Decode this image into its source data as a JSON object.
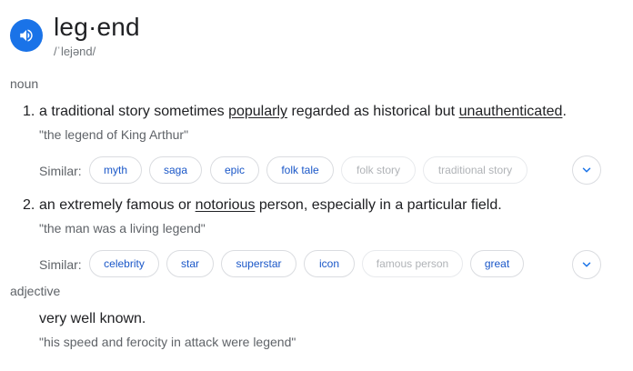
{
  "entry": {
    "word": "leg·end",
    "phonetic": "/ˈlejənd/",
    "speaker_icon": "volume-up-icon"
  },
  "noun": {
    "label": "noun",
    "senses": [
      {
        "number": "1.",
        "definition_parts": [
          {
            "text": "a traditional story sometimes ",
            "link": false
          },
          {
            "text": "popularly",
            "link": true
          },
          {
            "text": " regarded as historical but ",
            "link": false
          },
          {
            "text": "unauthenticated",
            "link": true
          },
          {
            "text": ".",
            "link": false
          }
        ],
        "example": "\"the legend of King Arthur\"",
        "similar_label": "Similar:",
        "similar": [
          {
            "text": "myth",
            "active": true
          },
          {
            "text": "saga",
            "active": true
          },
          {
            "text": "epic",
            "active": true
          },
          {
            "text": "folk tale",
            "active": true
          },
          {
            "text": "folk story",
            "active": false
          },
          {
            "text": "traditional story",
            "active": false
          }
        ]
      },
      {
        "number": "2.",
        "definition_parts": [
          {
            "text": "an extremely famous or ",
            "link": false
          },
          {
            "text": "notorious",
            "link": true
          },
          {
            "text": " person, especially in a particular field.",
            "link": false
          }
        ],
        "example": "\"the man was a living legend\"",
        "similar_label": "Similar:",
        "similar": [
          {
            "text": "celebrity",
            "active": true
          },
          {
            "text": "star",
            "active": true
          },
          {
            "text": "superstar",
            "active": true
          },
          {
            "text": "icon",
            "active": true
          },
          {
            "text": "famous person",
            "active": false
          },
          {
            "text": "great",
            "active": true
          }
        ]
      }
    ]
  },
  "adjective": {
    "label": "adjective",
    "senses": [
      {
        "definition": "very well known.",
        "example": "\"his speed and ferocity in attack were legend\""
      }
    ]
  },
  "icons": {
    "expand": "chevron-down-icon"
  },
  "colors": {
    "accent": "#1a73e8",
    "link_chip": "#1a57c8",
    "muted_text": "#5f6368"
  }
}
